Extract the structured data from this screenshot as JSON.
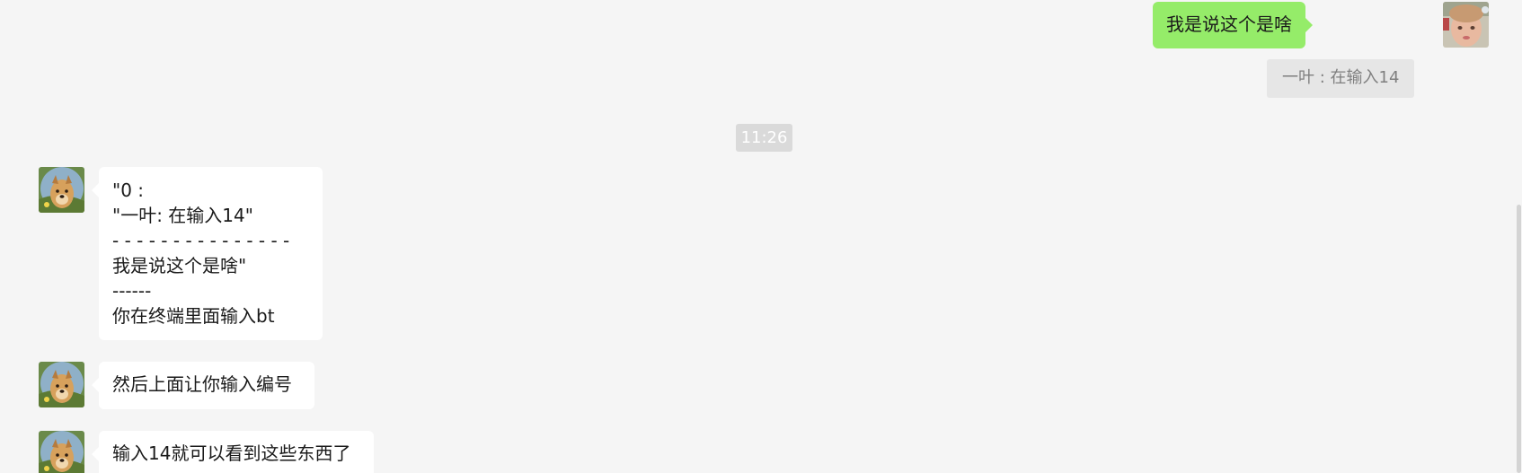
{
  "chat": {
    "outgoing": {
      "text": "我是说这个是啥",
      "quote": "一叶 : 在输入14"
    },
    "time_label": "11:26",
    "incoming": [
      {
        "lines": [
          "\"0 :",
          "\"一叶: 在输入14\"",
          "- - - - - - - - - - - - - - -",
          "我是说这个是啥\"",
          "------",
          "你在终端里面输入bt"
        ]
      },
      {
        "lines": [
          "然后上面让你输入编号"
        ]
      },
      {
        "lines": [
          "输入14就可以看到这些东西了"
        ]
      }
    ]
  },
  "colors": {
    "background": "#f5f5f5",
    "outgoing_bubble": "#95ec69",
    "incoming_bubble": "#ffffff",
    "quote_background": "#e6e6e6",
    "time_badge": "#dadada"
  },
  "icons": {
    "self_avatar": "portrait-avatar",
    "contact_avatar": "dog-avatar"
  }
}
